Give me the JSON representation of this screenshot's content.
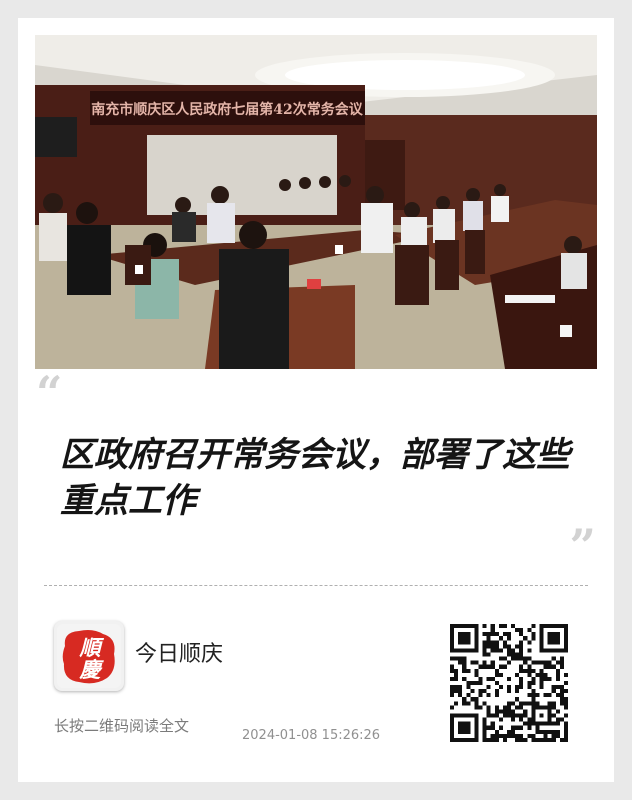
{
  "photo": {
    "alt": "会议现场照片",
    "banner_text": "南充市顺庆区人民政府七届第42次常务会议"
  },
  "quote": {
    "open": "“",
    "close": "”"
  },
  "headline": "区政府召开常务会议，部署了这些重点工作",
  "account": {
    "name": "今日顺庆",
    "logo_text": "順慶",
    "logo_color": "#d72a22"
  },
  "footer": {
    "hint": "长按二维码阅读全文",
    "timestamp": "2024-01-08 15:26:26"
  },
  "qr": {
    "icon": "qr-code-icon"
  }
}
